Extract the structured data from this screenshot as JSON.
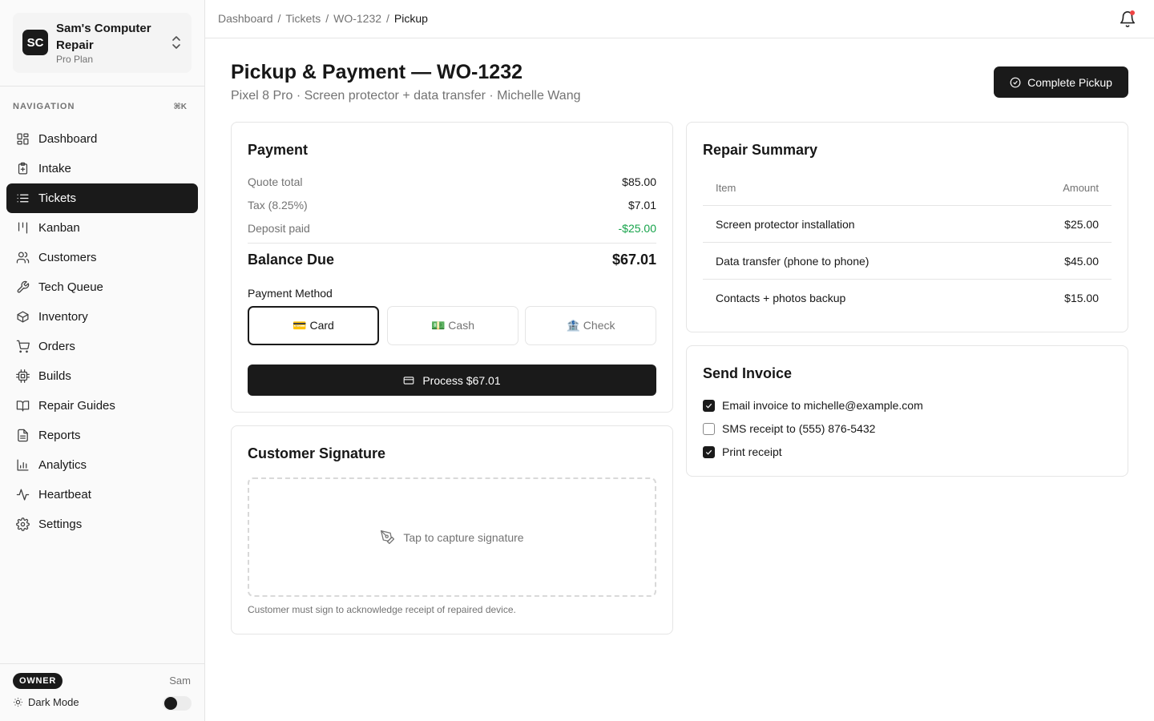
{
  "org": {
    "initials": "SC",
    "name": "Sam's Computer Repair",
    "plan": "Pro Plan"
  },
  "nav": {
    "heading": "NAVIGATION",
    "shortcut": "⌘K",
    "items": [
      {
        "label": "Dashboard",
        "icon": "dashboard-icon"
      },
      {
        "label": "Intake",
        "icon": "clipboard-plus-icon"
      },
      {
        "label": "Tickets",
        "icon": "list-icon",
        "active": true
      },
      {
        "label": "Kanban",
        "icon": "kanban-icon"
      },
      {
        "label": "Customers",
        "icon": "users-icon"
      },
      {
        "label": "Tech Queue",
        "icon": "wrench-icon"
      },
      {
        "label": "Inventory",
        "icon": "package-icon"
      },
      {
        "label": "Orders",
        "icon": "cart-icon"
      },
      {
        "label": "Builds",
        "icon": "cpu-icon"
      },
      {
        "label": "Repair Guides",
        "icon": "book-icon"
      },
      {
        "label": "Reports",
        "icon": "file-icon"
      },
      {
        "label": "Analytics",
        "icon": "bar-chart-icon"
      },
      {
        "label": "Heartbeat",
        "icon": "activity-icon"
      },
      {
        "label": "Settings",
        "icon": "gear-icon"
      }
    ]
  },
  "footer": {
    "role": "OWNER",
    "user": "Sam",
    "dark_mode_label": "Dark Mode"
  },
  "breadcrumb": {
    "items": [
      "Dashboard",
      "Tickets",
      "WO-1232"
    ],
    "current": "Pickup",
    "sep": "/"
  },
  "header": {
    "title": "Pickup & Payment — WO-1232",
    "subtitle": "Pixel 8 Pro · Screen protector + data transfer · Michelle Wang",
    "complete_label": "Complete Pickup"
  },
  "payment": {
    "title": "Payment",
    "quote_label": "Quote total",
    "quote_value": "$85.00",
    "tax_label": "Tax (8.25%)",
    "tax_value": "$7.01",
    "deposit_label": "Deposit paid",
    "deposit_value": "-$25.00",
    "balance_label": "Balance Due",
    "balance_value": "$67.01",
    "method_label": "Payment Method",
    "methods": [
      "💳 Card",
      "💵 Cash",
      "🏦 Check"
    ],
    "selected_method": 0,
    "process_label": "Process $67.01"
  },
  "signature": {
    "title": "Customer Signature",
    "prompt": "Tap to capture signature",
    "note": "Customer must sign to acknowledge receipt of repaired device."
  },
  "summary": {
    "title": "Repair Summary",
    "col_item": "Item",
    "col_amount": "Amount",
    "rows": [
      {
        "item": "Screen protector installation",
        "amount": "$25.00"
      },
      {
        "item": "Data transfer (phone to phone)",
        "amount": "$45.00"
      },
      {
        "item": "Contacts + photos backup",
        "amount": "$15.00"
      }
    ]
  },
  "invoice": {
    "title": "Send Invoice",
    "options": [
      {
        "label": "Email invoice to michelle@example.com",
        "checked": true
      },
      {
        "label": "SMS receipt to (555) 876-5432",
        "checked": false
      },
      {
        "label": "Print receipt",
        "checked": true
      }
    ]
  },
  "colors": {
    "accent": "#1a1a1a",
    "green": "#16a34a",
    "notification": "#ef4444"
  }
}
